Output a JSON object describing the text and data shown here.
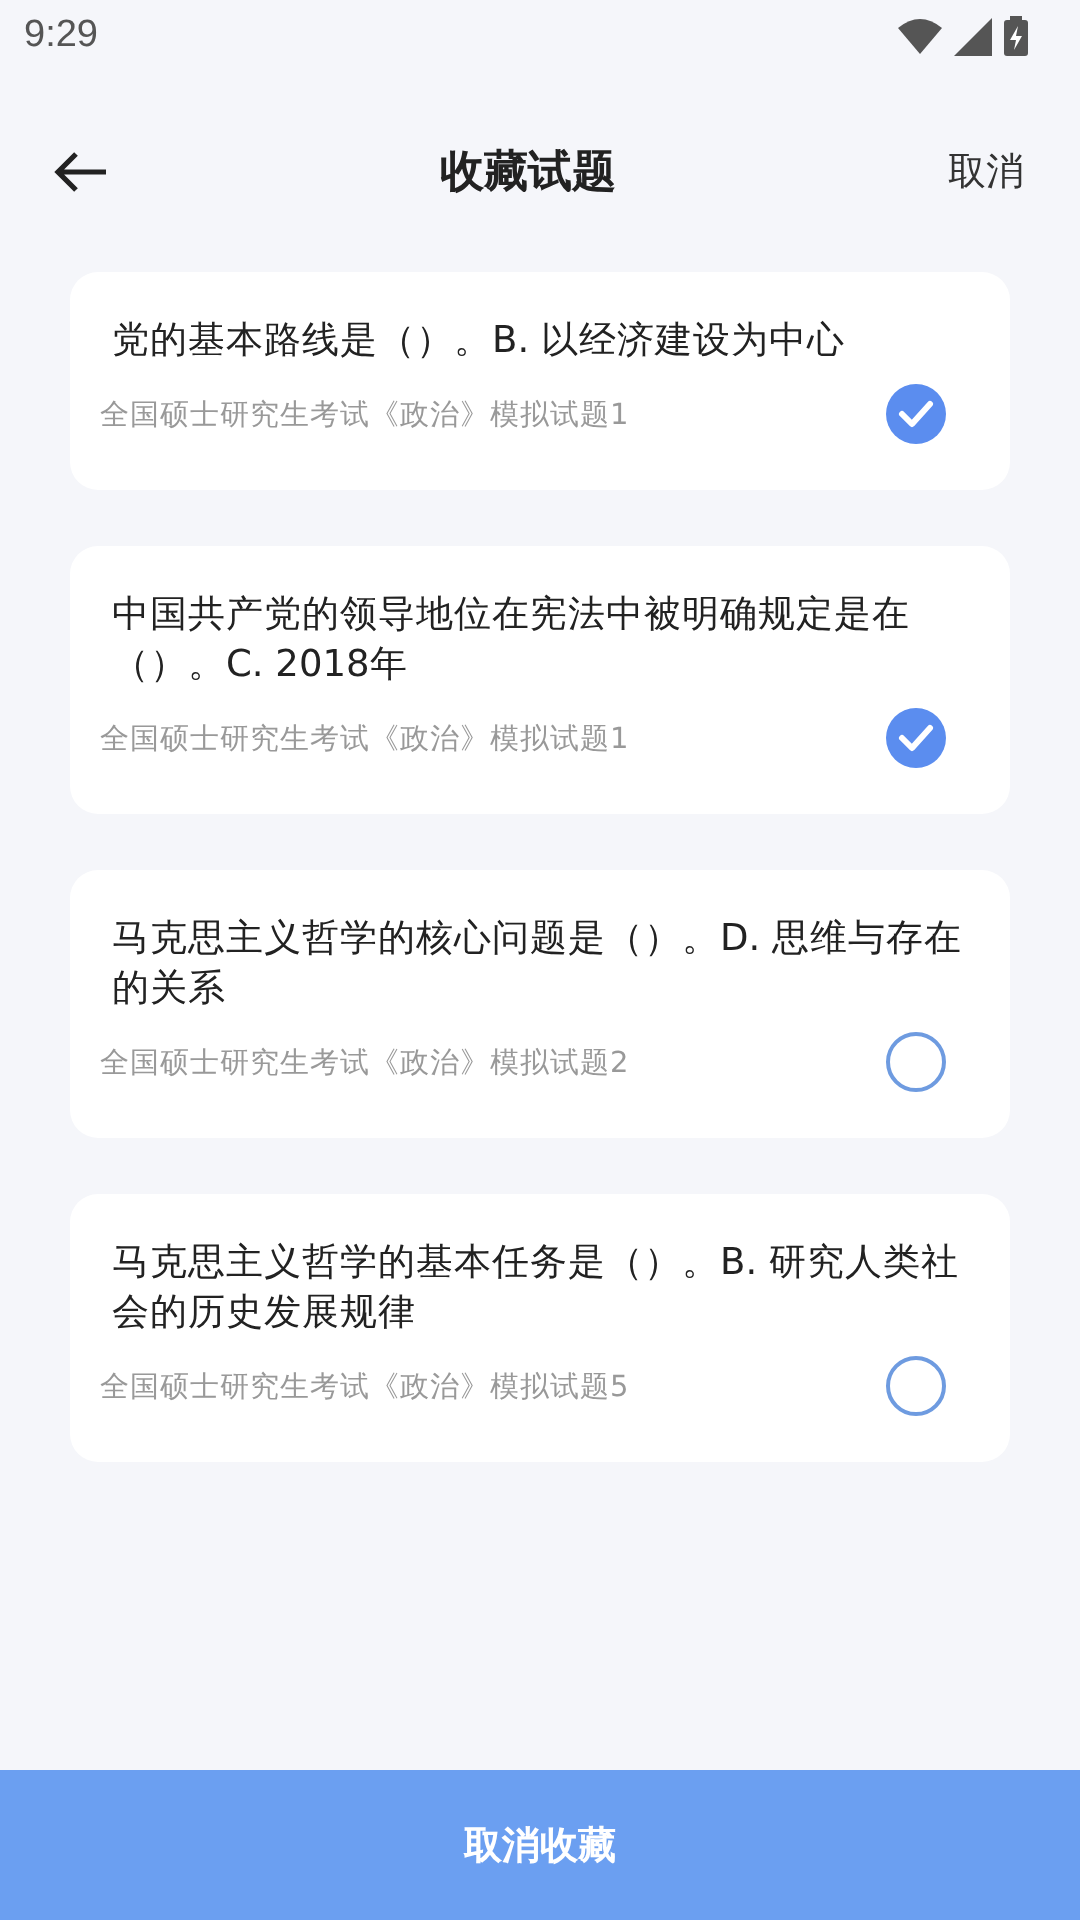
{
  "status_bar": {
    "time": "9:29"
  },
  "header": {
    "title": "收藏试题",
    "action": "取消"
  },
  "questions": [
    {
      "text": "党的基本路线是（）。B. 以经济建设为中心",
      "source": "全国硕士研究生考试《政治》模拟试题1",
      "checked": true
    },
    {
      "text": "中国共产党的领导地位在宪法中被明确规定是在（）。C. 2018年",
      "source": "全国硕士研究生考试《政治》模拟试题1",
      "checked": true
    },
    {
      "text": "马克思主义哲学的核心问题是（）。D. 思维与存在的关系",
      "source": "全国硕士研究生考试《政治》模拟试题2",
      "checked": false
    },
    {
      "text": "马克思主义哲学的基本任务是（）。B. 研究人类社会的历史发展规律",
      "source": "全国硕士研究生考试《政治》模拟试题5",
      "checked": false
    }
  ],
  "bottom_button": "取消收藏"
}
